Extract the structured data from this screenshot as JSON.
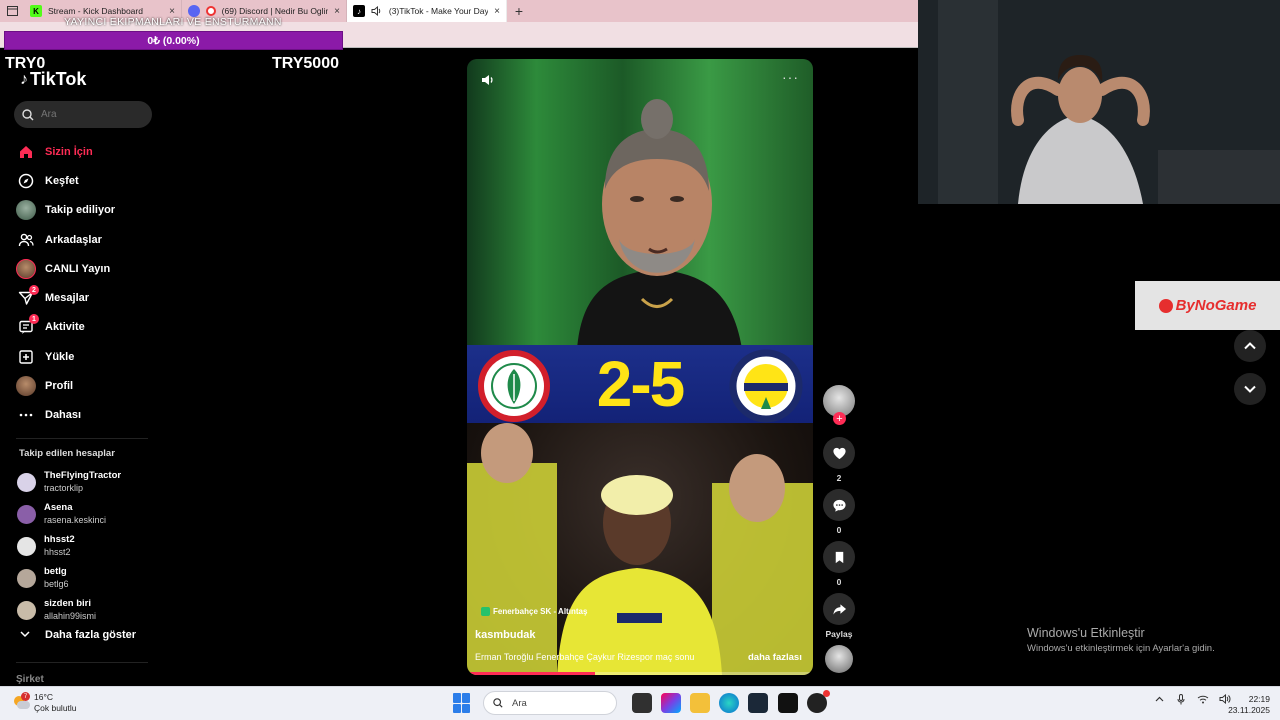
{
  "browser": {
    "tabs": [
      {
        "title": "Stream - Kick Dashboard",
        "active": false,
        "favicon_color": "#53fc18"
      },
      {
        "title": "(69) Discord | Nedir Bu Oglin",
        "active": false,
        "favicon_color": "#5865f2"
      },
      {
        "title": "(3)TikTok - Make Your Day",
        "active": true,
        "favicon_color": "#000000"
      }
    ],
    "new_tab": "+",
    "close": "×"
  },
  "overlay": {
    "title": "YAYINCI EKIPMANLARI VE ENSTURMANN",
    "progress_text": "0₺ (0.00%)",
    "progress_fraction": 0,
    "progress_color": "#8b1aa8",
    "try_left": "TRY0",
    "try_right": "TRY5000"
  },
  "tiktok": {
    "logo": "TikTok",
    "search_placeholder": "Ara",
    "accent": "#fe2c55",
    "nav": [
      {
        "label": "Sizin İçin",
        "icon": "home-icon",
        "active": true
      },
      {
        "label": "Keşfet",
        "icon": "compass-icon"
      },
      {
        "label": "Takip ediliyor",
        "icon": "avatar"
      },
      {
        "label": "Arkadaşlar",
        "icon": "friends-icon"
      },
      {
        "label": "CANLI Yayın",
        "icon": "avatar"
      },
      {
        "label": "Mesajlar",
        "icon": "send-icon",
        "badge": "2"
      },
      {
        "label": "Aktivite",
        "icon": "inbox-icon",
        "badge": "1"
      },
      {
        "label": "Yükle",
        "icon": "upload-icon"
      },
      {
        "label": "Profil",
        "icon": "avatar"
      },
      {
        "label": "Dahası",
        "icon": "more-icon"
      }
    ],
    "following_header": "Takip edilen hesaplar",
    "following": [
      {
        "name": "TheFlyingTractor",
        "handle": "tractorklip",
        "color": "#d9d2e8"
      },
      {
        "name": "Asena",
        "handle": "rasena.keskinci",
        "color": "#8a5fa8"
      },
      {
        "name": "hhsst2",
        "handle": "hhsst2",
        "color": "#e5e5e5"
      },
      {
        "name": "betlg",
        "handle": "betlg6",
        "color": "#b5a79a"
      },
      {
        "name": "sizden biri",
        "handle": "allahin99ismi",
        "color": "#c8bba8"
      }
    ],
    "show_more": "Daha fazla göster",
    "company": "Şirket"
  },
  "video": {
    "score": "2-5",
    "home_crest": "ÇAYKUR RİZESPOR KULÜBÜ 1955",
    "away_crest": "FENERBAHÇE SPOR KULÜBÜ 1907",
    "tag": "Fenerbahçe SK - Altıntaş",
    "username": "kasmbudak",
    "caption": "Erman Toroğlu Fenerbahçe Çaykur Rizespor maç sonu",
    "more": "daha fazlası",
    "progress_fraction": 0.37,
    "more_dots": "···"
  },
  "actions": {
    "likes": "2",
    "comments": "0",
    "saves": "0",
    "share": "Paylaş"
  },
  "right": {
    "sponsor": "ByNoGame",
    "activate_title": "Windows'u Etkinleştir",
    "activate_sub": "Windows'u etkinleştirmek için Ayarlar'a gidin."
  },
  "taskbar": {
    "temp": "16°C",
    "weather": "Çok bulutlu",
    "weather_badge": "7",
    "search_placeholder": "Ara",
    "time": "22:19",
    "date": "23.11.2025"
  }
}
